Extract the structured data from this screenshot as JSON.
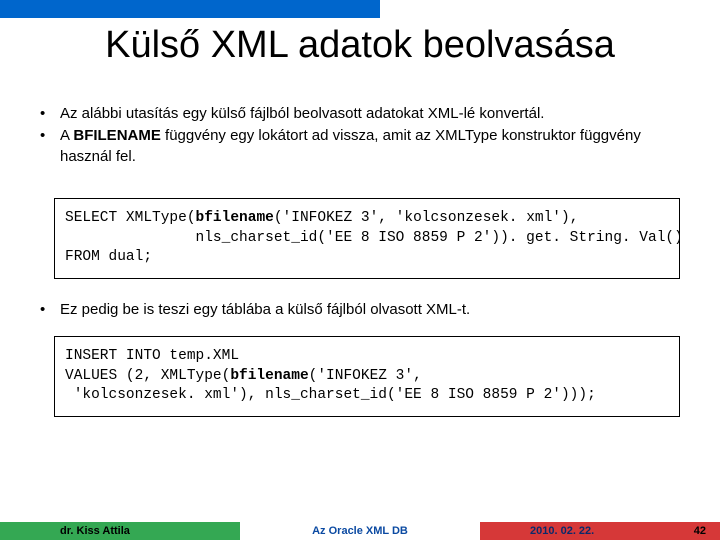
{
  "title": "Külső XML adatok beolvasása",
  "bullets1": [
    "Az alábbi utasítás egy külső fájlból beolvasott adatokat XML-lé konvertál.",
    "A BFILENAME függvény egy lokátort ad vissza, amit az XMLType konstruktor függvény használ fel."
  ],
  "bullet1b_prefix": "A ",
  "bullet1b_bold": "BFILENAME",
  "bullet1b_suffix": " függvény egy lokátort ad vissza, amit az XMLType konstruktor függvény használ fel.",
  "code1_line1a": "SELECT XMLType(",
  "code1_line1b": "bfilename",
  "code1_line1c": "('INFOKEZ 3', 'kolcsonzesek. xml'),",
  "code1_line2": "               nls_charset_id('EE 8 ISO 8859 P 2')). get. String. Val()",
  "code1_line3": "FROM dual;",
  "bullets2": [
    "Ez pedig be is teszi egy táblába a külső fájlból olvasott XML-t."
  ],
  "code2_line1": "INSERT INTO temp.XML",
  "code2_line2a": "VALUES (2, XMLType(",
  "code2_line2b": "bfilename",
  "code2_line2c": "('INFOKEZ 3',",
  "code2_line3": " 'kolcsonzesek. xml'), nls_charset_id('EE 8 ISO 8859 P 2')));",
  "footer": {
    "author": "dr. Kiss Attila",
    "center": "Az Oracle XML DB",
    "date": "2010. 02. 22.",
    "page": "42"
  }
}
